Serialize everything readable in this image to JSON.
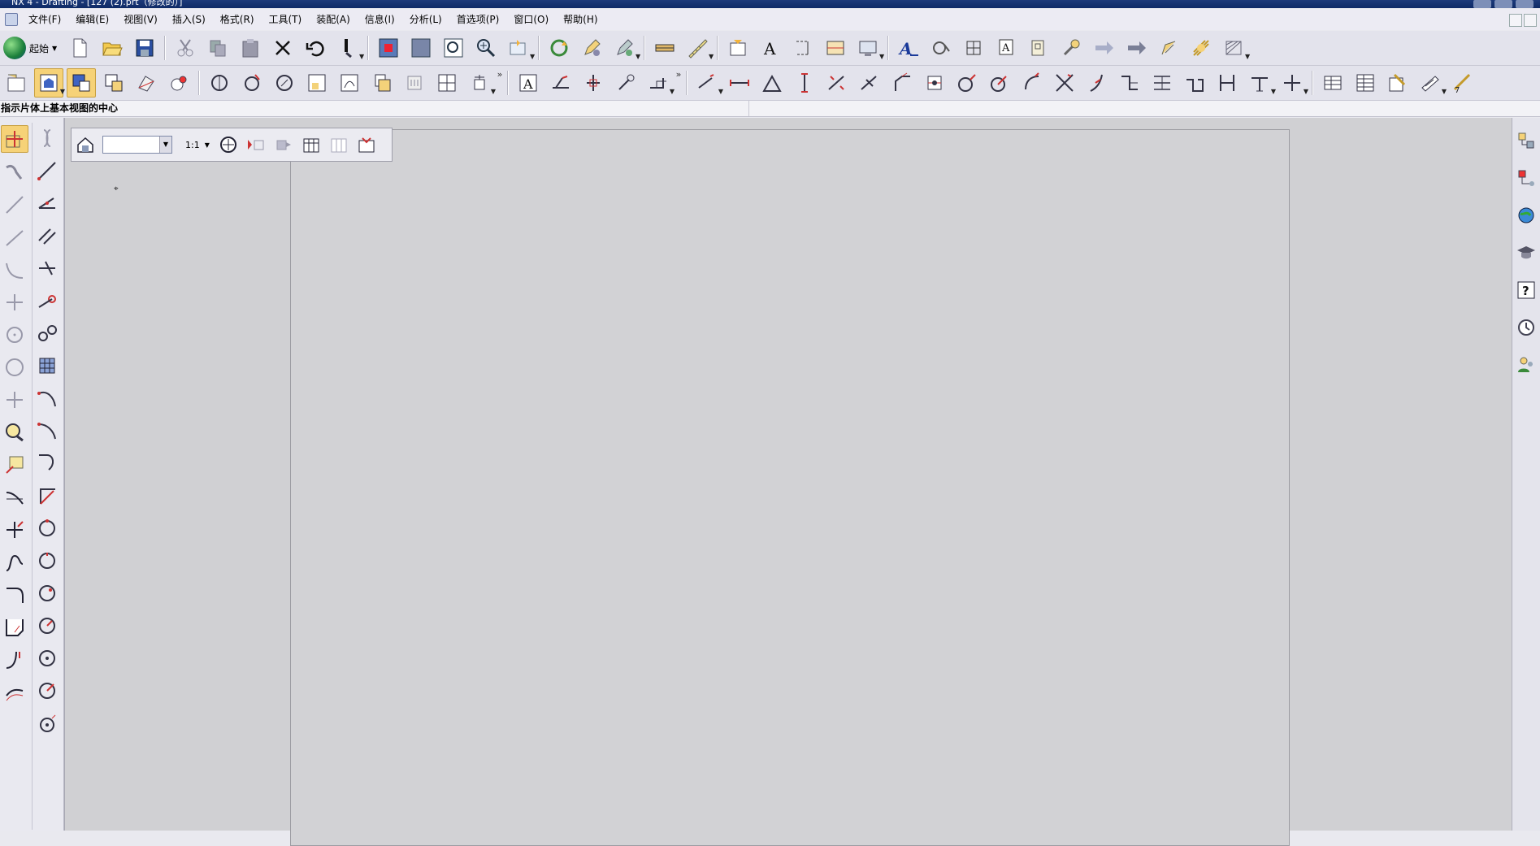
{
  "window": {
    "title": "NX 4 - Drafting - [127 (2).prt（修改的）]"
  },
  "menubar": {
    "items": [
      "文件(F)",
      "编辑(E)",
      "视图(V)",
      "插入(S)",
      "格式(R)",
      "工具(T)",
      "装配(A)",
      "信息(I)",
      "分析(L)",
      "首选项(P)",
      "窗口(O)",
      "帮助(H)"
    ]
  },
  "toolbar": {
    "start_label": "起始",
    "more_glyph": "»"
  },
  "cue_line": {
    "text": "指示片体上基本视图的中心"
  },
  "view_toolbar": {
    "scale_label": "1:1",
    "view_select_value": ""
  },
  "workspace": {
    "cursor_glyph": "⌖"
  },
  "colors": {
    "active_tool": "#f6d277",
    "canvas": "#d0d0d3",
    "titlebar": "#0e2a66"
  }
}
